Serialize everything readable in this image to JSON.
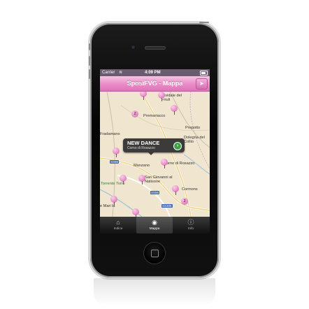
{
  "colors": {
    "accent": "#e98cc6",
    "navbar": "#de74b9",
    "tabbar": "#111111"
  },
  "status_bar": {
    "carrier": "Carrier",
    "wifi_icon": "wifi-icon",
    "time": "4:09 PM",
    "battery_icon": "battery-icon"
  },
  "nav": {
    "title": "SposiFVG - Mappa",
    "location_icon": "location-arrow-icon"
  },
  "map": {
    "places": [
      "Cividale del Friuli",
      "Premariacco",
      "Prepotto",
      "Dolegna del Collio",
      "Fradamano",
      "Manzano",
      "orno di Rosazzo",
      "San Giovanni al Natisone",
      "Torrente Torre",
      "Cormons",
      "e Mari la"
    ],
    "roads": [
      "SS56",
      "SS56",
      "SS305"
    ],
    "clusters": [
      "2",
      "2"
    ],
    "callout": {
      "title": "NEW DANCE",
      "subtitle": "Corno di Rosazzo"
    }
  },
  "tabs": [
    {
      "label": "Indice",
      "icon": "house-icon"
    },
    {
      "label": "Mappa",
      "icon": "globe-icon"
    },
    {
      "label": "Info",
      "icon": "info-icon"
    }
  ]
}
